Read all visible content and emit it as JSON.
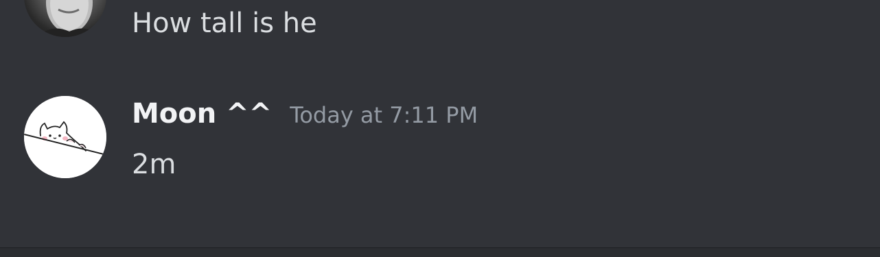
{
  "messages": [
    {
      "text": "How tall is he",
      "avatar": "user-photo-avatar"
    },
    {
      "username": "Moon ^^",
      "timestamp": "Today at 7:11 PM",
      "text": "2m",
      "avatar": "white-cat-avatar"
    }
  ],
  "colors": {
    "background": "#313338",
    "message_text": "#dbdee1",
    "username": "#f2f3f5",
    "timestamp": "#949ba4"
  }
}
